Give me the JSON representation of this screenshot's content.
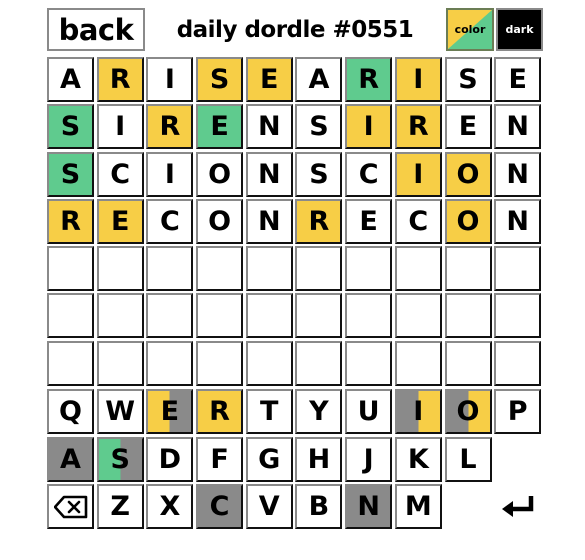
{
  "header": {
    "back_label": "back",
    "title": "daily dordle #0551",
    "color_label": "color",
    "dark_label": "dark"
  },
  "colors": {
    "yellow": "#f7ce46",
    "green": "#5fcb8e",
    "gray": "#8a8a8a",
    "white": "#ffffff"
  },
  "boards": {
    "rows": [
      {
        "letters": [
          "A",
          "R",
          "I",
          "S",
          "E",
          "A",
          "R",
          "I",
          "S",
          "E"
        ],
        "states": [
          "w",
          "y",
          "w",
          "y",
          "y",
          "w",
          "g",
          "y",
          "w",
          "w"
        ]
      },
      {
        "letters": [
          "S",
          "I",
          "R",
          "E",
          "N",
          "S",
          "I",
          "R",
          "E",
          "N"
        ],
        "states": [
          "g",
          "w",
          "y",
          "g",
          "w",
          "w",
          "y",
          "y",
          "w",
          "w"
        ]
      },
      {
        "letters": [
          "S",
          "C",
          "I",
          "O",
          "N",
          "S",
          "C",
          "I",
          "O",
          "N"
        ],
        "states": [
          "g",
          "w",
          "w",
          "w",
          "w",
          "w",
          "w",
          "y",
          "y",
          "w"
        ]
      },
      {
        "letters": [
          "R",
          "E",
          "C",
          "O",
          "N",
          "R",
          "E",
          "C",
          "O",
          "N"
        ],
        "states": [
          "y",
          "y",
          "w",
          "w",
          "w",
          "y",
          "w",
          "w",
          "y",
          "w"
        ]
      },
      {
        "letters": [
          "",
          "",
          "",
          "",
          "",
          "",
          "",
          "",
          "",
          ""
        ],
        "states": [
          "w",
          "w",
          "w",
          "w",
          "w",
          "w",
          "w",
          "w",
          "w",
          "w"
        ]
      },
      {
        "letters": [
          "",
          "",
          "",
          "",
          "",
          "",
          "",
          "",
          "",
          ""
        ],
        "states": [
          "w",
          "w",
          "w",
          "w",
          "w",
          "w",
          "w",
          "w",
          "w",
          "w"
        ]
      },
      {
        "letters": [
          "",
          "",
          "",
          "",
          "",
          "",
          "",
          "",
          "",
          ""
        ],
        "states": [
          "w",
          "w",
          "w",
          "w",
          "w",
          "w",
          "w",
          "w",
          "w",
          "w"
        ]
      }
    ]
  },
  "keyboard": {
    "rows": [
      [
        {
          "key": "Q",
          "left": "w",
          "right": "w"
        },
        {
          "key": "W",
          "left": "w",
          "right": "w"
        },
        {
          "key": "E",
          "left": "y",
          "right": "x"
        },
        {
          "key": "R",
          "left": "y",
          "right": "y"
        },
        {
          "key": "T",
          "left": "w",
          "right": "w"
        },
        {
          "key": "Y",
          "left": "w",
          "right": "w"
        },
        {
          "key": "U",
          "left": "w",
          "right": "w"
        },
        {
          "key": "I",
          "left": "x",
          "right": "y"
        },
        {
          "key": "O",
          "left": "x",
          "right": "y"
        },
        {
          "key": "P",
          "left": "w",
          "right": "w"
        }
      ],
      [
        {
          "key": "A",
          "left": "x",
          "right": "x"
        },
        {
          "key": "S",
          "left": "g",
          "right": "x"
        },
        {
          "key": "D",
          "left": "w",
          "right": "w"
        },
        {
          "key": "F",
          "left": "w",
          "right": "w"
        },
        {
          "key": "G",
          "left": "w",
          "right": "w"
        },
        {
          "key": "H",
          "left": "w",
          "right": "w"
        },
        {
          "key": "J",
          "left": "w",
          "right": "w"
        },
        {
          "key": "K",
          "left": "w",
          "right": "w"
        },
        {
          "key": "L",
          "left": "w",
          "right": "w"
        },
        {
          "key": "",
          "left": "w",
          "right": "w",
          "blank": true
        }
      ],
      [
        {
          "key": "backspace-icon",
          "left": "w",
          "right": "w",
          "icon": "backspace"
        },
        {
          "key": "Z",
          "left": "w",
          "right": "w"
        },
        {
          "key": "X",
          "left": "w",
          "right": "w"
        },
        {
          "key": "C",
          "left": "x",
          "right": "x"
        },
        {
          "key": "V",
          "left": "w",
          "right": "w"
        },
        {
          "key": "B",
          "left": "w",
          "right": "w"
        },
        {
          "key": "N",
          "left": "x",
          "right": "x"
        },
        {
          "key": "M",
          "left": "w",
          "right": "w"
        },
        {
          "key": "",
          "left": "w",
          "right": "w",
          "blank": true
        },
        {
          "key": "enter-icon",
          "left": "w",
          "right": "w",
          "icon": "enter",
          "blank": true
        }
      ]
    ]
  }
}
